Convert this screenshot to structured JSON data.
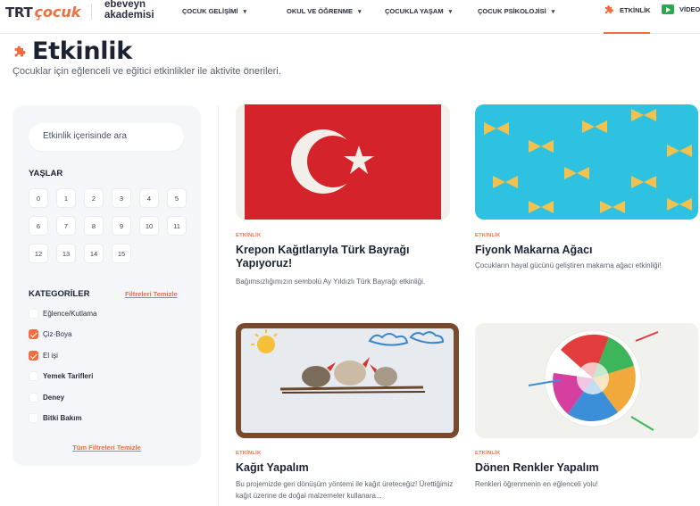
{
  "header": {
    "logo_trt": "TRT",
    "logo_cocuk": "çocuk",
    "brand_line1": "ebeveyn",
    "brand_line2": "akademisi",
    "nav": [
      {
        "label": "ÇOCUK GELİŞİMİ"
      },
      {
        "label": "OKUL VE ÖĞRENME"
      },
      {
        "label": "ÇOCUKLA YAŞAM"
      },
      {
        "label": "ÇOCUK PSİKOLOJİSİ"
      }
    ],
    "right_nav": [
      {
        "label": "ETKİNLİK",
        "icon": "puzzle-icon",
        "active": true
      },
      {
        "label": "VİDEO",
        "icon": "video-play-icon"
      }
    ],
    "accent_color": "#f26d3d"
  },
  "page": {
    "title": "Etkinlik",
    "subtitle": "Çocuklar için eğlenceli ve eğitici etkinlikler ile aktivite önerileri."
  },
  "sidebar": {
    "search_placeholder": "Etkinlik içerisinde ara",
    "ages_title": "YAŞLAR",
    "ages": [
      "0",
      "1",
      "2",
      "3",
      "4",
      "5",
      "6",
      "7",
      "8",
      "9",
      "10",
      "11",
      "12",
      "13",
      "14",
      "15"
    ],
    "categories_title": "KATEGORİLER",
    "clear_filters": "Filtreleri Temizle",
    "categories": [
      {
        "label": "Eğlence/Kutlama",
        "checked": false
      },
      {
        "label": "Çiz-Boya",
        "checked": true
      },
      {
        "label": "El işi",
        "checked": true
      },
      {
        "label": "Yemek Tarifleri",
        "checked": false
      },
      {
        "label": "Deney",
        "checked": false
      },
      {
        "label": "Bitki Bakım",
        "checked": false
      }
    ],
    "clear_all": "Tüm Filtreleri Temizle"
  },
  "cards": [
    {
      "tag": "ETKİNLİK",
      "title": "Krepon Kağıtlarıyla Türk Bayrağı Yapıyoruz!",
      "desc": "Bağımsızlığımızın sembolü Ay Yıldızlı Türk Bayrağı etkinliği."
    },
    {
      "tag": "ETKİNLİK",
      "title": "Fiyonk Makarna Ağacı",
      "desc": "Çocukların hayal gücünü geliştiren makarna ağacı etkinliği!"
    },
    {
      "tag": "ETKİNLİK",
      "title": "Kağıt Yapalım",
      "desc": "Bu projemizde geri dönüşüm yöntemi ile kağıt üreteceğiz! Ürettiğimiz kağıt üzerine de doğal malzemeler kullanara..."
    },
    {
      "tag": "ETKİNLİK",
      "title": "Dönen Renkler Yapalım",
      "desc": "Renkleri öğrenmenin en eğlenceli yolu!"
    }
  ]
}
